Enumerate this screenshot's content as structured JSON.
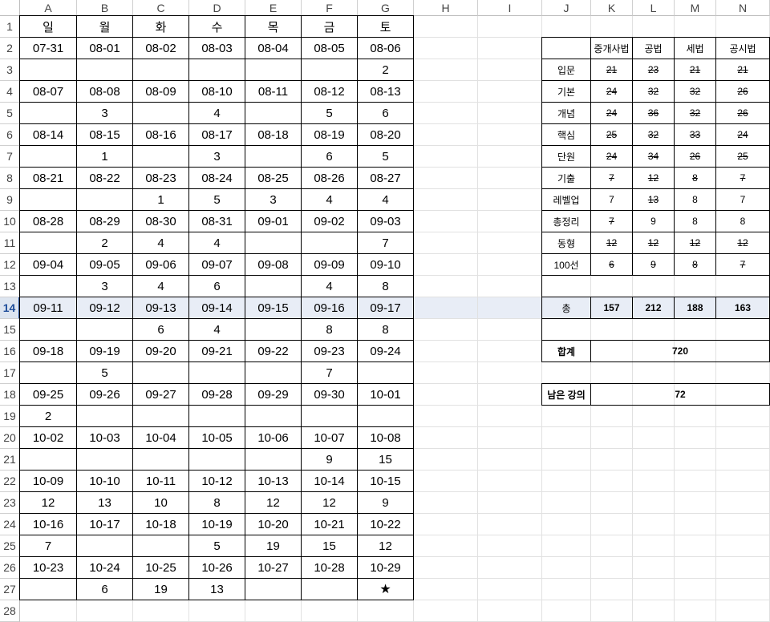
{
  "columns": [
    "A",
    "B",
    "C",
    "D",
    "E",
    "F",
    "G",
    "H",
    "I",
    "J",
    "K",
    "L",
    "M",
    "N"
  ],
  "rows": [
    "1",
    "2",
    "3",
    "4",
    "5",
    "6",
    "7",
    "8",
    "9",
    "10",
    "11",
    "12",
    "13",
    "14",
    "15",
    "16",
    "17",
    "18",
    "19",
    "20",
    "21",
    "22",
    "23",
    "24",
    "25",
    "26",
    "27",
    "28"
  ],
  "selected_row": "14",
  "calendar": {
    "weekdays": [
      "일",
      "월",
      "화",
      "수",
      "목",
      "금",
      "토"
    ],
    "weeks": [
      {
        "dates": [
          "07-31",
          "08-01",
          "08-02",
          "08-03",
          "08-04",
          "08-05",
          "08-06"
        ],
        "counts": [
          "",
          "",
          "",
          "",
          "",
          "",
          "2"
        ]
      },
      {
        "dates": [
          "08-07",
          "08-08",
          "08-09",
          "08-10",
          "08-11",
          "08-12",
          "08-13"
        ],
        "counts": [
          "",
          "3",
          "",
          "4",
          "",
          "5",
          "6"
        ]
      },
      {
        "dates": [
          "08-14",
          "08-15",
          "08-16",
          "08-17",
          "08-18",
          "08-19",
          "08-20"
        ],
        "counts": [
          "",
          "1",
          "",
          "3",
          "",
          "6",
          "5"
        ]
      },
      {
        "dates": [
          "08-21",
          "08-22",
          "08-23",
          "08-24",
          "08-25",
          "08-26",
          "08-27"
        ],
        "counts": [
          "",
          "",
          "1",
          "5",
          "3",
          "4",
          "4"
        ]
      },
      {
        "dates": [
          "08-28",
          "08-29",
          "08-30",
          "08-31",
          "09-01",
          "09-02",
          "09-03"
        ],
        "counts": [
          "",
          "2",
          "4",
          "4",
          "",
          "",
          "7"
        ]
      },
      {
        "dates": [
          "09-04",
          "09-05",
          "09-06",
          "09-07",
          "09-08",
          "09-09",
          "09-10"
        ],
        "counts": [
          "",
          "3",
          "4",
          "6",
          "",
          "4",
          "8"
        ]
      },
      {
        "dates": [
          "09-11",
          "09-12",
          "09-13",
          "09-14",
          "09-15",
          "09-16",
          "09-17"
        ],
        "counts": [
          "",
          "",
          "6",
          "4",
          "",
          "8",
          "8"
        ]
      },
      {
        "dates": [
          "09-18",
          "09-19",
          "09-20",
          "09-21",
          "09-22",
          "09-23",
          "09-24"
        ],
        "counts": [
          "",
          "5",
          "",
          "",
          "",
          "7",
          ""
        ]
      },
      {
        "dates": [
          "09-25",
          "09-26",
          "09-27",
          "09-28",
          "09-29",
          "09-30",
          "10-01"
        ],
        "counts": [
          "2",
          "",
          "",
          "",
          "",
          "",
          ""
        ]
      },
      {
        "dates": [
          "10-02",
          "10-03",
          "10-04",
          "10-05",
          "10-06",
          "10-07",
          "10-08"
        ],
        "counts": [
          "",
          "",
          "",
          "",
          "",
          "9",
          "15"
        ]
      },
      {
        "dates": [
          "10-09",
          "10-10",
          "10-11",
          "10-12",
          "10-13",
          "10-14",
          "10-15"
        ],
        "counts": [
          "12",
          "13",
          "10",
          "8",
          "12",
          "12",
          "9"
        ]
      },
      {
        "dates": [
          "10-16",
          "10-17",
          "10-18",
          "10-19",
          "10-20",
          "10-21",
          "10-22"
        ],
        "counts": [
          "7",
          "",
          "",
          "5",
          "19",
          "15",
          "12"
        ]
      },
      {
        "dates": [
          "10-23",
          "10-24",
          "10-25",
          "10-26",
          "10-27",
          "10-28",
          "10-29"
        ],
        "counts": [
          "",
          "6",
          "19",
          "13",
          "",
          "",
          "★"
        ]
      }
    ]
  },
  "subject_table": {
    "headers": [
      "중개사법",
      "공법",
      "세법",
      "공시법"
    ],
    "rows": [
      {
        "label": "입문",
        "values": [
          "21",
          "23",
          "21",
          "21"
        ],
        "struck": [
          true,
          true,
          true,
          true
        ]
      },
      {
        "label": "기본",
        "values": [
          "24",
          "32",
          "32",
          "26"
        ],
        "struck": [
          true,
          true,
          true,
          true
        ]
      },
      {
        "label": "개념",
        "values": [
          "24",
          "36",
          "32",
          "26"
        ],
        "struck": [
          true,
          true,
          true,
          true
        ]
      },
      {
        "label": "핵심",
        "values": [
          "25",
          "32",
          "33",
          "24"
        ],
        "struck": [
          true,
          true,
          true,
          true
        ]
      },
      {
        "label": "단원",
        "values": [
          "24",
          "34",
          "26",
          "25"
        ],
        "struck": [
          true,
          true,
          true,
          true
        ]
      },
      {
        "label": "기출",
        "values": [
          "7",
          "12",
          "8",
          "7"
        ],
        "struck": [
          true,
          true,
          true,
          true
        ]
      },
      {
        "label": "레벨업",
        "values": [
          "7",
          "13",
          "8",
          "7"
        ],
        "struck": [
          false,
          true,
          false,
          false
        ]
      },
      {
        "label": "총정리",
        "values": [
          "7",
          "9",
          "8",
          "8"
        ],
        "struck": [
          true,
          false,
          false,
          false
        ]
      },
      {
        "label": "동형",
        "values": [
          "12",
          "12",
          "12",
          "12"
        ],
        "struck": [
          true,
          true,
          true,
          true
        ]
      },
      {
        "label": "100선",
        "values": [
          "6",
          "9",
          "8",
          "7"
        ],
        "struck": [
          true,
          true,
          true,
          true
        ]
      }
    ],
    "total": {
      "label": "총",
      "values": [
        "157",
        "212",
        "188",
        "163"
      ]
    },
    "sum": {
      "label": "합계",
      "value": "720"
    },
    "remaining": {
      "label": "남은 강의",
      "value": "72"
    }
  }
}
